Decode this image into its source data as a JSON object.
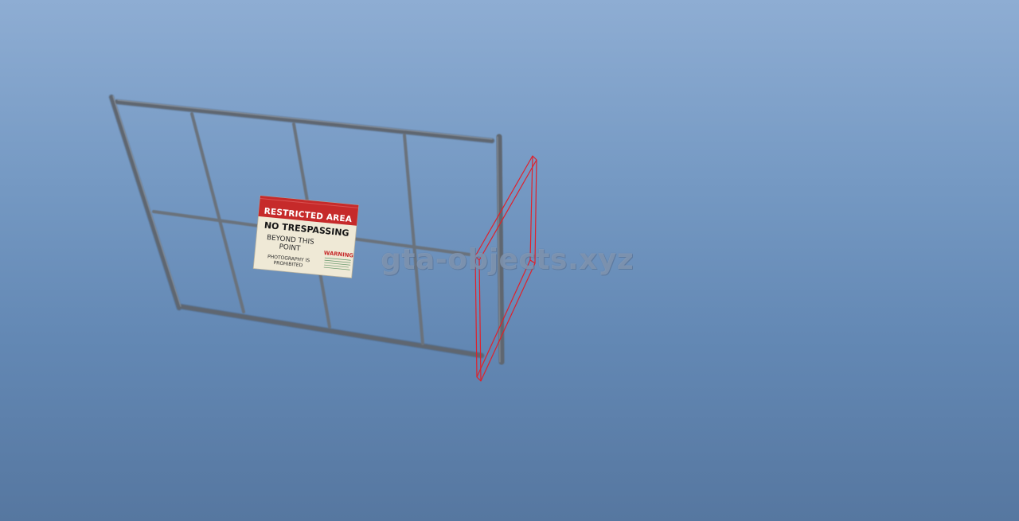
{
  "sign": {
    "header": "RESTRICTED AREA",
    "line1": "NO TRESPASSING",
    "line2a": "BEYOND THIS",
    "line2b": "POINT",
    "line3a": "PHOTOGRAPHY IS",
    "line3b": "PROHIBITED",
    "warning": "WARNING"
  },
  "watermark": {
    "text": "gta-objects.xyz"
  },
  "colors": {
    "sky_top": "#8eadd3",
    "sky_bottom": "#5677a0",
    "fence_metal": "#5f6670",
    "sign_red": "#c62a2a",
    "sign_paper": "#efe9d6",
    "bbox_outline": "#e0202a"
  }
}
